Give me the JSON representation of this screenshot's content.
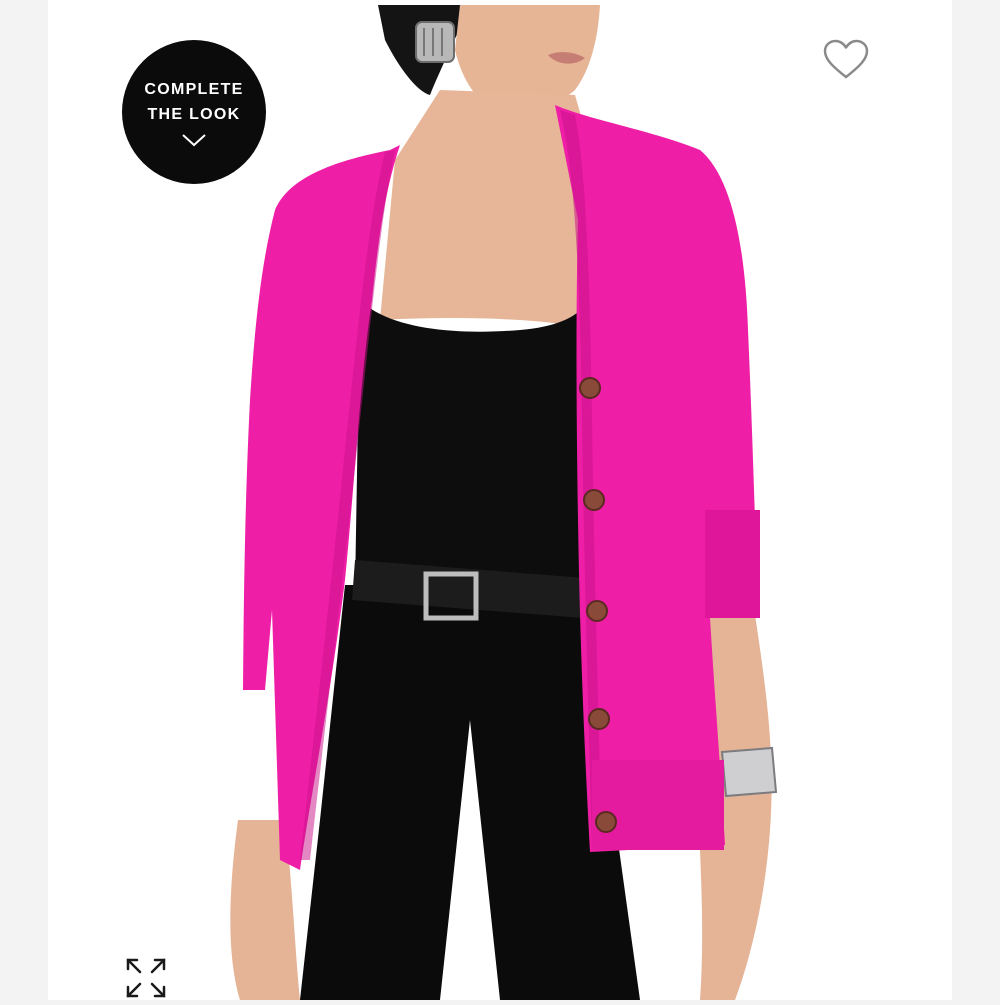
{
  "badge": {
    "line1": "COMPLETE",
    "line2": "THE LOOK",
    "icon": "chevron-down-icon"
  },
  "actions": {
    "favorite_icon": "heart-outline-icon",
    "expand_icon": "expand-arrows-icon"
  },
  "colors": {
    "cardigan": "#ef1ea6",
    "cardigan_shadow": "#c9128a",
    "outfit_black": "#0d0d0d",
    "skin": "#e8b99c",
    "badge_bg": "#0b0b0b"
  }
}
